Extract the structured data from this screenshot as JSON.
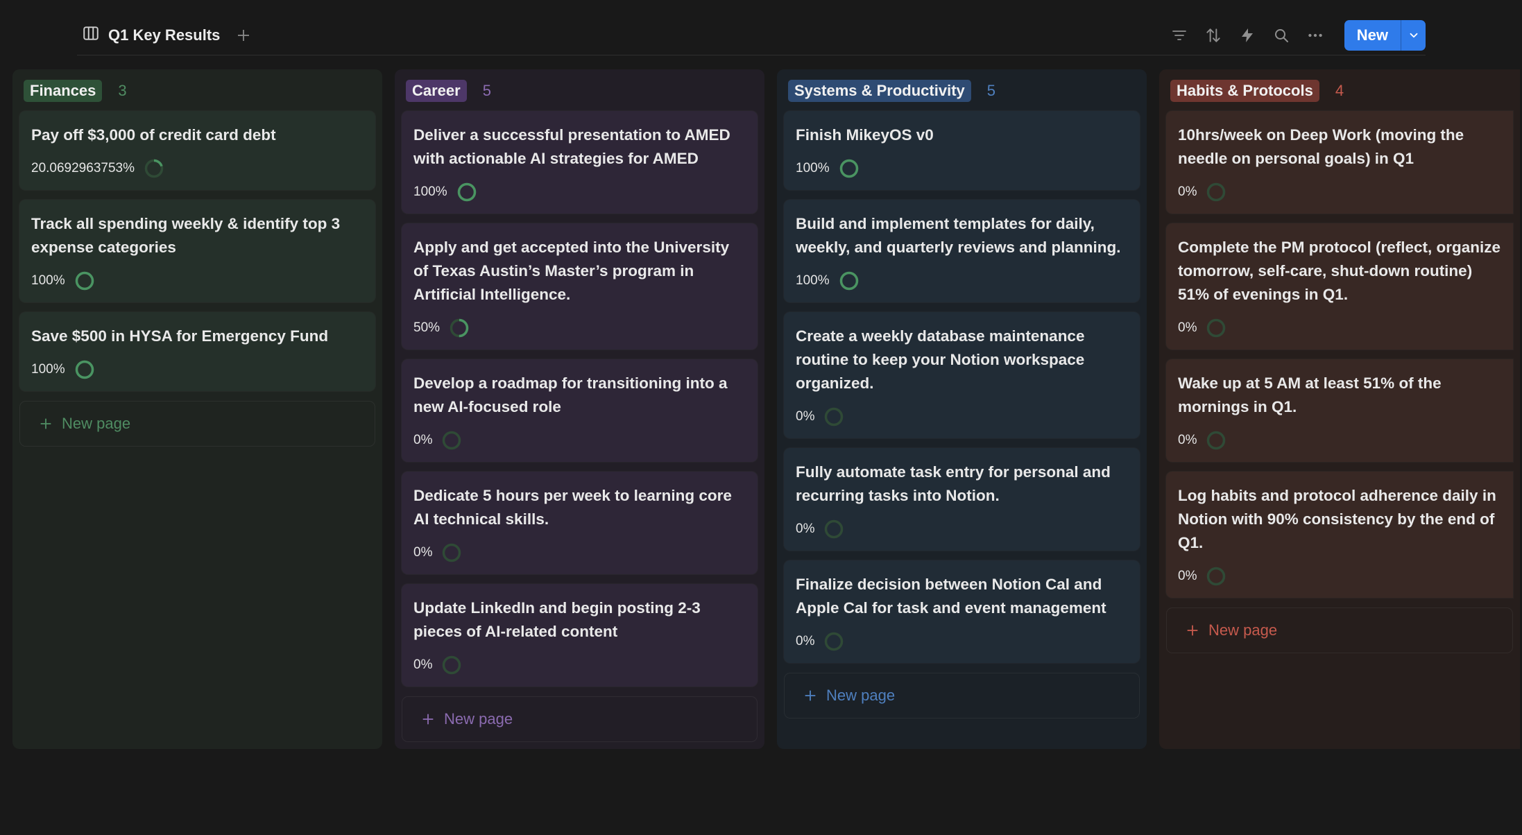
{
  "header": {
    "view_title": "Q1 Key Results",
    "view_icon": "board-icon",
    "new_label": "New",
    "toolbar_icons": [
      "filter-icon",
      "sort-icon",
      "automation-icon",
      "search-icon",
      "more-icon"
    ]
  },
  "colors": {
    "ring_track": "#2f4a36",
    "ring_fill": "#4a9462",
    "accent": "#2f7bea"
  },
  "columns": [
    {
      "name": "Finances",
      "count": "3",
      "cards": [
        {
          "title": "Pay off $3,000 of credit card debt",
          "progress_text": "20.0692963753%",
          "progress": 0.2007
        },
        {
          "title": "Track all spending weekly & identify top 3 expense categories",
          "progress_text": "100%",
          "progress": 1
        },
        {
          "title": "Save $500 in HYSA for Emergency Fund",
          "progress_text": "100%",
          "progress": 1
        }
      ],
      "new_page_label": "New page"
    },
    {
      "name": "Career",
      "count": "5",
      "cards": [
        {
          "title": "Deliver a successful presentation to AMED with actionable AI strategies for AMED",
          "progress_text": "100%",
          "progress": 1
        },
        {
          "title": "Apply and get accepted into the University of Texas Austin’s Master’s program in Artificial Intelligence.",
          "progress_text": "50%",
          "progress": 0.5
        },
        {
          "title": "Develop a roadmap for transitioning into a new AI-focused role",
          "progress_text": "0%",
          "progress": 0
        },
        {
          "title": "Dedicate 5 hours per week to learning core AI technical skills.",
          "progress_text": "0%",
          "progress": 0
        },
        {
          "title": "Update LinkedIn and begin posting 2-3 pieces of AI-related content",
          "progress_text": "0%",
          "progress": 0
        }
      ],
      "new_page_label": "New page"
    },
    {
      "name": "Systems & Productivity",
      "count": "5",
      "cards": [
        {
          "title": "Finish MikeyOS v0",
          "progress_text": "100%",
          "progress": 1
        },
        {
          "title": "Build and implement templates for daily, weekly, and quarterly reviews and planning.",
          "progress_text": "100%",
          "progress": 1
        },
        {
          "title": "Create a weekly database maintenance routine to keep your Notion workspace organized.",
          "progress_text": "0%",
          "progress": 0
        },
        {
          "title": "Fully automate task entry for personal and recurring tasks into Notion.",
          "progress_text": "0%",
          "progress": 0
        },
        {
          "title": "Finalize decision between Notion Cal and Apple Cal for task and event management",
          "progress_text": "0%",
          "progress": 0
        }
      ],
      "new_page_label": "New page"
    },
    {
      "name": "Habits & Protocols",
      "count": "4",
      "cards": [
        {
          "title": "10hrs/week on Deep Work (moving the needle on personal goals) in Q1",
          "progress_text": "0%",
          "progress": 0
        },
        {
          "title": "Complete the PM protocol (reflect, organize tomorrow, self-care, shut-down routine) 51% of evenings in Q1.",
          "progress_text": "0%",
          "progress": 0
        },
        {
          "title": "Wake up at 5 AM at least 51% of the mornings in Q1.",
          "progress_text": "0%",
          "progress": 0
        },
        {
          "title": "Log habits and protocol adherence daily in Notion with 90% consistency by the end of Q1.",
          "progress_text": "0%",
          "progress": 0
        }
      ],
      "new_page_label": "New page"
    }
  ]
}
